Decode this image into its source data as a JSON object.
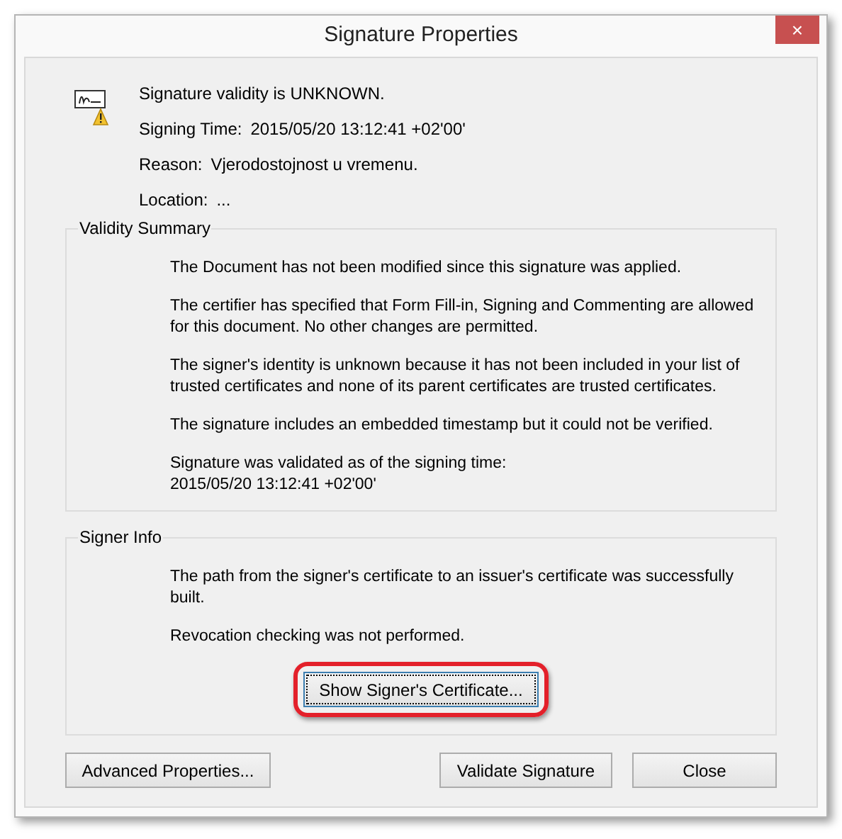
{
  "window": {
    "title": "Signature Properties",
    "close": "×"
  },
  "header": {
    "status": "Signature validity is UNKNOWN.",
    "fields": [
      {
        "label": "Signing Time:",
        "value": "2015/05/20 13:12:41 +02'00'"
      },
      {
        "label": "Reason:",
        "value": "Vjerodostojnost u vremenu."
      },
      {
        "label": "Location:",
        "value": "..."
      }
    ]
  },
  "validity_summary": {
    "title": "Validity Summary",
    "paragraphs": [
      "The Document has not been modified since this signature was applied.",
      "The certifier has specified that Form Fill-in, Signing and Commenting are allowed for this document. No other changes are permitted.",
      "The signer's identity is unknown because it has not been included in your list of trusted certificates and none of its parent certificates are trusted certificates.",
      "The signature includes an embedded timestamp but it could not be verified.",
      "Signature was validated as of the signing time:\n2015/05/20 13:12:41 +02'00'"
    ]
  },
  "signer_info": {
    "title": "Signer Info",
    "paragraphs": [
      "The path from the signer's certificate to an issuer's certificate was successfully built.",
      "Revocation checking was not performed."
    ],
    "button": {
      "label": "Show Signer's Certificate...",
      "focused": true,
      "highlighted": true
    }
  },
  "buttons": [
    {
      "label": "Advanced Properties..."
    },
    {
      "label": "Validate Signature"
    },
    {
      "label": "Close"
    }
  ]
}
